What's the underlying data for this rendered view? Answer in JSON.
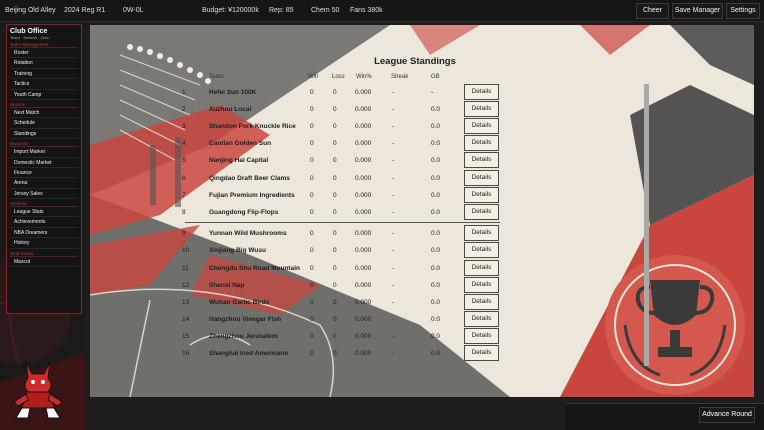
{
  "topbar": {
    "team": "Beijing Old Alley",
    "season": "2024 Reg R1",
    "record": "0W-0L",
    "budget": "Budget: ¥120000k",
    "rep": "Rep: 85",
    "chem": "Chem 50",
    "fans": "Fans 380k",
    "cheer_label": "Cheer",
    "save_label": "Save Manager",
    "settings_label": "Settings"
  },
  "sidebar": {
    "title": "Club Office",
    "subtitle": "Team · Season · Club",
    "sections": [
      {
        "name": "Team Management",
        "items": [
          "Roster",
          "Rotation",
          "Training",
          "Tactics",
          "Youth Camp"
        ]
      },
      {
        "name": "Season",
        "items": [
          "Next Match",
          "Schedule",
          "Standings"
        ]
      },
      {
        "name": "Business",
        "items": [
          "Import Market",
          "Domestic Market",
          "Finance",
          "Arena",
          "Jersey Sales"
        ]
      },
      {
        "name": "Archives",
        "items": [
          "League Stats",
          "Achievements",
          "NBA Dreamers",
          "History"
        ]
      },
      {
        "name": "Club Extras",
        "items": [
          "Mascot"
        ]
      }
    ]
  },
  "standings": {
    "title": "League Standings",
    "headers": {
      "rank": "",
      "team": "Team",
      "win": "Win",
      "loss": "Loss",
      "pct": "Win%",
      "streak": "Streak",
      "gb": "GB"
    },
    "details_label": "Details",
    "rows": [
      {
        "rank": "1",
        "team": "Hefei Sun 100K",
        "win": "0",
        "loss": "0",
        "pct": "0.000",
        "streak": "-",
        "gb": "-"
      },
      {
        "rank": "2",
        "team": "Xuzhou Local",
        "win": "0",
        "loss": "0",
        "pct": "0.000",
        "streak": "-",
        "gb": "0.0"
      },
      {
        "rank": "3",
        "team": "Shandon Pork Knuckle Rice",
        "win": "0",
        "loss": "0",
        "pct": "0.000",
        "streak": "-",
        "gb": "0.0"
      },
      {
        "rank": "4",
        "team": "Cantian Golden Sun",
        "win": "0",
        "loss": "0",
        "pct": "0.000",
        "streak": "-",
        "gb": "0.0"
      },
      {
        "rank": "5",
        "team": "Nanjing Hai Capital",
        "win": "0",
        "loss": "0",
        "pct": "0.000",
        "streak": "-",
        "gb": "0.0"
      },
      {
        "rank": "6",
        "team": "Qingdao Draft Beer Clams",
        "win": "0",
        "loss": "0",
        "pct": "0.000",
        "streak": "-",
        "gb": "0.0"
      },
      {
        "rank": "7",
        "team": "Fujian Premium Ingredients",
        "win": "0",
        "loss": "0",
        "pct": "0.000",
        "streak": "-",
        "gb": "0.0"
      },
      {
        "rank": "8",
        "team": "Guangdong Flip-Flops",
        "win": "0",
        "loss": "0",
        "pct": "0.000",
        "streak": "-",
        "gb": "0.0"
      },
      {
        "rank": "9",
        "team": "Yunnan Wild Mushrooms",
        "win": "0",
        "loss": "0",
        "pct": "0.000",
        "streak": "-",
        "gb": "0.0"
      },
      {
        "rank": "10",
        "team": "Xinjiang Big Wusu",
        "win": "0",
        "loss": "0",
        "pct": "0.000",
        "streak": "-",
        "gb": "0.0"
      },
      {
        "rank": "11",
        "team": "Chengdu Shu Road Mountain",
        "win": "0",
        "loss": "0",
        "pct": "0.000",
        "streak": "-",
        "gb": "0.0"
      },
      {
        "rank": "12",
        "team": "Shanxi Nap",
        "win": "0",
        "loss": "0",
        "pct": "0.000",
        "streak": "-",
        "gb": "0.0"
      },
      {
        "rank": "13",
        "team": "Wuhan Garlic Birds",
        "win": "0",
        "loss": "0",
        "pct": "0.000",
        "streak": "-",
        "gb": "0.0"
      },
      {
        "rank": "14",
        "team": "Hangzhou Vinegar Fish",
        "win": "0",
        "loss": "0",
        "pct": "0.000",
        "streak": "-",
        "gb": "0.0"
      },
      {
        "rank": "15",
        "team": "Zhengzhou Jerusalem",
        "win": "0",
        "loss": "0",
        "pct": "0.000",
        "streak": "-",
        "gb": "0.0"
      },
      {
        "rank": "16",
        "team": "Shanghai Iced Americano",
        "win": "0",
        "loss": "0",
        "pct": "0.000",
        "streak": "-",
        "gb": "0.0"
      }
    ]
  },
  "footer": {
    "advance_label": "Advance Round"
  },
  "colors": {
    "accent": "#c9463f",
    "panel": "#ede6da",
    "dark": "#1d1d1d",
    "grey": "#6d6d6a"
  },
  "icons": {
    "mascot": "red-fox-mascot-icon",
    "trophy": "trophy-icon",
    "stadium": "stadium-stands-illustration"
  }
}
